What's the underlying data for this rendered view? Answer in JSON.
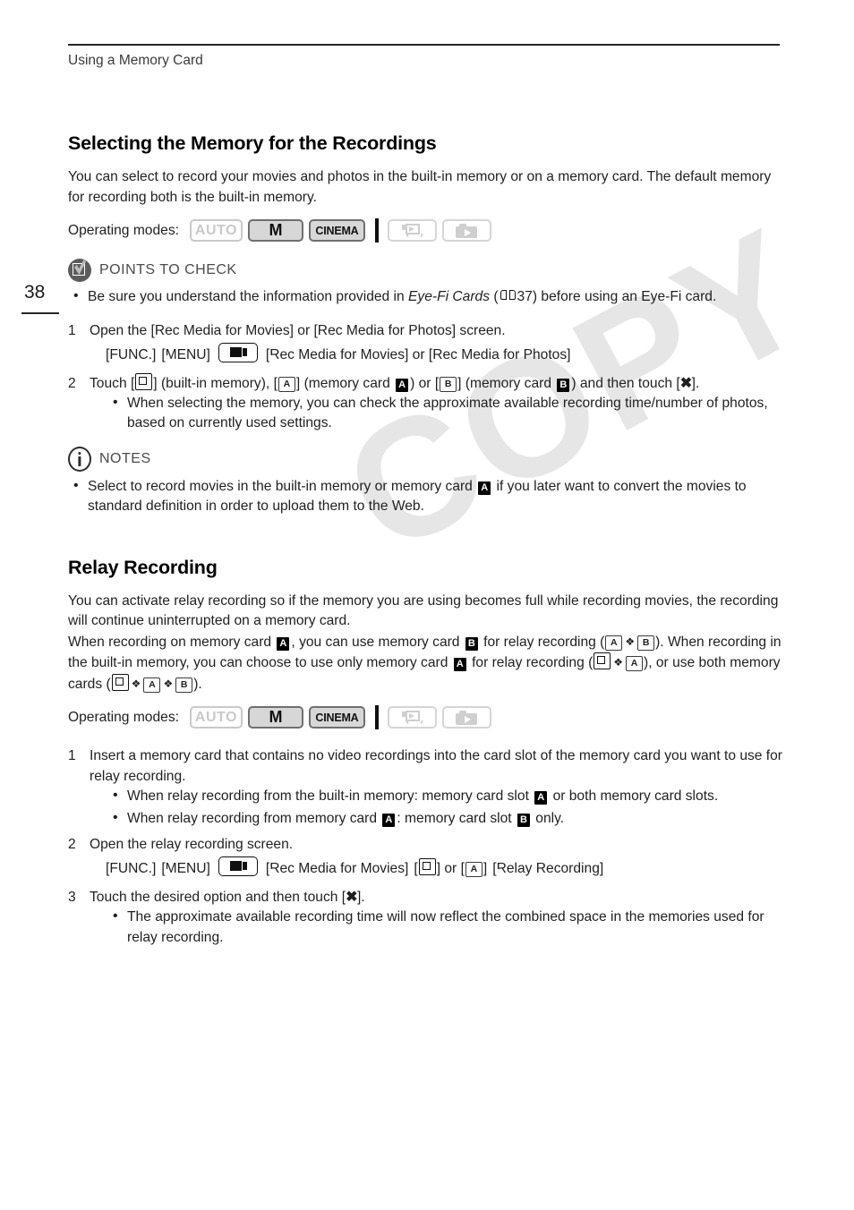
{
  "page": {
    "running_head": "Using a Memory Card",
    "page_number": "38",
    "watermark": "COPY"
  },
  "section1": {
    "title": "Selecting the Memory for the Recordings",
    "intro": "You can select to record your movies and photos in the built-in memory or on a memory card. The default memory for recording both is the built-in memory.",
    "operating_modes": {
      "label": "Operating modes:",
      "badges": [
        {
          "name": "auto",
          "label": "AUTO",
          "state": "inactive"
        },
        {
          "name": "manual",
          "label": "M",
          "state": "active"
        },
        {
          "name": "cinema",
          "label": "CINEMA",
          "state": "active"
        },
        {
          "name": "playback-movies",
          "label": "",
          "state": "inactive"
        },
        {
          "name": "playback-photos",
          "label": "",
          "state": "inactive"
        }
      ]
    },
    "points_to_check": {
      "title": "POINTS TO CHECK",
      "bullets": [
        {
          "pre": "Be sure you understand the information provided in ",
          "italic": "Eye-Fi Cards",
          "mid": " (",
          "page_ref": "37",
          "post": ") before using an Eye-Fi card."
        }
      ]
    },
    "steps": [
      {
        "num": "1",
        "text": "Open the [Rec Media for Movies] or [Rec Media for Photos] screen.",
        "path": {
          "func": "[FUNC.]",
          "menu": "[MENU]",
          "tail": "[Rec Media for Movies] or [Rec Media for Photos]"
        }
      },
      {
        "num": "2",
        "parts": {
          "p1": "Touch [",
          "p2": "] (built-in memory), [",
          "p3": "] (memory card ",
          "p4": ") or [",
          "p5": "] (memory card ",
          "p6": ") and then touch [",
          "p7": "].",
          "box_a": "A",
          "box_b": "B",
          "solid_a": "A",
          "solid_b": "B",
          "close": "✖"
        },
        "bullets": [
          "When selecting the memory, you can check the approximate available recording time/number of photos, based on currently used settings."
        ]
      }
    ],
    "notes": {
      "title": "NOTES",
      "bullets": [
        {
          "pre": "Select to record movies in the built-in memory or memory card ",
          "card": "A",
          "post": " if you later want to convert the movies to standard definition in order to upload them to the Web."
        }
      ]
    }
  },
  "section2": {
    "title": "Relay Recording",
    "paragraph1": "You can activate relay recording so if the memory you are using becomes full while recording movies, the recording will continue uninterrupted on a memory card.",
    "paragraph2": {
      "s1": "When recording on memory card ",
      "card_a1": "A",
      "s2": ", you can use memory card ",
      "card_b1": "B",
      "s3": " for relay recording (",
      "box_a1": "A",
      "arrow1": "❖",
      "box_b1": "B",
      "s4": "). When recording in the built-in memory, you can choose to use only memory card ",
      "card_a2": "A",
      "s5": " for relay recording (",
      "arrow2": "❖",
      "box_a2": "A",
      "s6": "), or use both memory cards (",
      "arrow3": "❖",
      "box_a3": "A",
      "arrow4": "❖",
      "box_b2": "B",
      "s7": ")."
    },
    "operating_modes": {
      "label": "Operating modes:",
      "badges": [
        {
          "name": "auto",
          "label": "AUTO",
          "state": "inactive"
        },
        {
          "name": "manual",
          "label": "M",
          "state": "active"
        },
        {
          "name": "cinema",
          "label": "CINEMA",
          "state": "active"
        },
        {
          "name": "playback-movies",
          "label": "",
          "state": "inactive"
        },
        {
          "name": "playback-photos",
          "label": "",
          "state": "inactive"
        }
      ]
    },
    "steps": [
      {
        "num": "1",
        "text": "Insert a memory card that contains no video recordings into the card slot of the memory card you want to use for relay recording.",
        "bullets": [
          {
            "pre": "When relay recording from the built-in memory: memory card slot ",
            "card": "A",
            "post": " or both memory card slots."
          },
          {
            "pre": "When relay recording from memory card ",
            "card": "A",
            "mid": ": memory card slot ",
            "card2": "B",
            "post": " only."
          }
        ]
      },
      {
        "num": "2",
        "text": "Open the relay recording screen.",
        "path": {
          "func": "[FUNC.]",
          "menu": "[MENU]",
          "mid1": "[Rec Media for Movies]",
          "mid2": "] or [",
          "box_a": "A",
          "tail": "[Relay Recording]"
        }
      },
      {
        "num": "3",
        "parts": {
          "p1": "Touch the desired option and then touch [",
          "close": "✖",
          "p2": "]."
        },
        "bullets": [
          "The approximate available recording time will now reflect the combined space in the memories used for relay recording."
        ]
      }
    ]
  }
}
